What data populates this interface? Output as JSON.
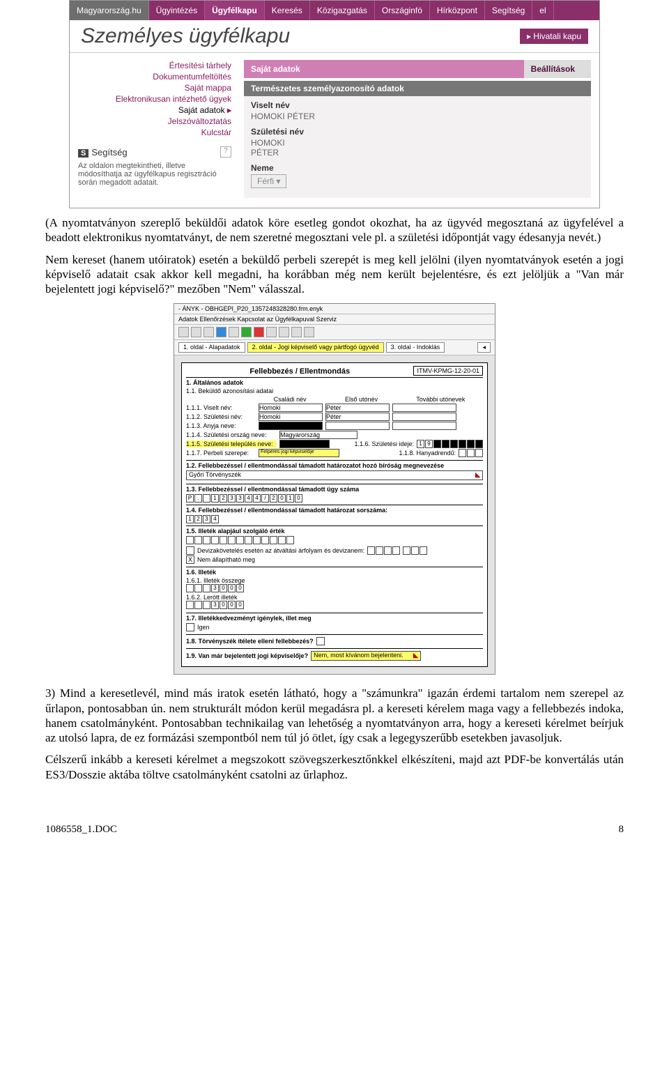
{
  "shot1": {
    "top": [
      "Magyarország.hu",
      "Ügyintézés",
      "Ügyfélkapu",
      "Keresés",
      "Közigazgatás",
      "Országinfó",
      "Hírközpont",
      "Segítség",
      "el"
    ],
    "top_selected_index": 2,
    "title": "Személyes ügyfélkapu",
    "hivatali": "▸ Hivatali kapu",
    "leftmenu": {
      "items": [
        "Értesítési tárhely",
        "Dokumentumfeltöltés",
        "Saját mappa",
        "Elektronikusan intézhető ügyek",
        "Saját adatok",
        "Jelszóváltoztatás",
        "Kulcstár"
      ],
      "selected_index": 4,
      "help_badge": "S",
      "help_title": "Segítség",
      "help_text": "Az oldalon megtekintheti, illetve módosíthatja az ügyfélkapus regisztráció során megadott adatait."
    },
    "tabs": {
      "t1": "Saját adatok",
      "t2": "Beállítások"
    },
    "section_head": "Természetes személyazonosító adatok",
    "fields": {
      "viselt_lbl": "Viselt név",
      "viselt_val": "HOMOKI PÉTER",
      "szul_lbl": "Születési név",
      "szul_val1": "HOMOKI",
      "szul_val2": "PÉTER",
      "neme_lbl": "Neme",
      "neme_val": "Férfi"
    }
  },
  "para1": "(A nyomtatványon szereplő beküldői adatok köre esetleg gondot okozhat, ha az ügyvéd megosztaná az ügyfelével a beadott elektronikus nyomtatványt, de nem szeretné megosztani vele pl. a születési időpontját vagy édesanyja nevét.)",
  "para2": "Nem kereset (hanem utóiratok) esetén a beküldő perbeli szerepét is meg kell jelölni (ilyen nyomtatványok esetén a jogi képviselő adatait csak akkor kell megadni, ha korábban még nem került bejelentésre, és ezt jelöljük a \"Van már bejelentett jogi képviselő?\" mezőben \"Nem\" válasszal.",
  "shot2": {
    "win": "- ÁNYK - OBHGEPI_P20_1357248328280.frm.enyk",
    "menu": "Adatok   Ellenőrzések   Kapcsolat az Ügyfélkapuval   Szerviz",
    "pagetabs": {
      "t1": "1. oldal - Alapadatok",
      "t2": "2. oldal - Jogi képviselő vagy pártfogó ügyvéd",
      "t3": "3. oldal - Indoklás"
    },
    "form": {
      "title": "Fellebbezés / Ellentmondás",
      "form_id": "ITMV-KPMG-12-20-01",
      "s1_head": "1. Általános adatok",
      "s11": "1.1. Beküldő azonosítási adatai",
      "hcols": [
        "Családi név",
        "Első utónév",
        "További utónevek"
      ],
      "r111_lab": "1.1.1. Viselt név:",
      "r111_a": "Homoki",
      "r111_b": "Péter",
      "r112_lab": "1.1.2. Születési név:",
      "r112_a": "Homoki",
      "r112_b": "Péter",
      "r113_lab": "1.1.3. Anyja neve:",
      "r114_lab": "1.1.4. Születési ország neve:",
      "r114_val": "Magyarország",
      "r115_lab": "1.1.5. Születési település neve:",
      "r116_lab": "1.1.6. Születési ideje:",
      "r116_val": "19",
      "r117_lab": "1.1.7. Perbeli szerepe:",
      "r117_val": "Felperes jogi képviselője",
      "r118_lab": "1.1.8. Hanyadrendű:",
      "s12": "1.2. Fellebbezéssel / ellentmondással támadott határozatot hozó bíróság megnevezése",
      "s12_val": "Győri Törvényszék",
      "s13": "1.3. Fellebbezéssel / ellentmondással támadott ügy száma",
      "s13_boxes": [
        "P",
        ".",
        "",
        "1",
        "2",
        "3",
        "3",
        "4",
        "4",
        "/",
        "2",
        "0",
        "1",
        "0"
      ],
      "s14": "1.4. Fellebbezéssel / ellentmondással támadott határozat sorszáma:",
      "s14_boxes": [
        "1",
        "2",
        "3",
        "4"
      ],
      "s15": "1.5. Illeték alapjául szolgáló érték",
      "s15_opt1": "Devizakövetelés esetén az átváltási árfolyam és devizanem:",
      "s15_opt2": "Nem állapítható meg",
      "s15_opt2_checked": "X",
      "s16": "1.6. Illeték",
      "s161": "1.6.1. Illeték összege",
      "s161_boxes": [
        "",
        "",
        "",
        "3",
        "0",
        "0",
        "0"
      ],
      "s162": "1.6.2. Lerótt illeték",
      "s162_boxes": [
        "",
        "",
        "",
        "3",
        "0",
        "0",
        "0"
      ],
      "s17": "1.7. Illetékkedvezményt igénylek, illet meg",
      "s17_opt": "Igen",
      "s18": "1.8. Törvényszék ítélete elleni fellebbezés?",
      "s19": "1.9. Van már bejelentett jogi képviselője?",
      "s19_val": "Nem, most kívánom bejelenteni."
    }
  },
  "para3": "3) Mind a keresetlevél, mind más iratok esetén látható, hogy a \"számunkra\" igazán érdemi tartalom nem szerepel az űrlapon, pontosabban ún. nem strukturált módon kerül megadásra pl. a kereseti kérelem maga vagy a fellebbezés indoka, hanem csatolmányként. Pontosabban technikailag van lehetőség a nyomtatványon arra, hogy a kereseti kérelmet beírjuk az utolsó lapra, de ez formázási szempontból nem túl jó ötlet, így csak a legegyszerűbb esetekben javasoljuk.",
  "para4": "Célszerű inkább a kereseti kérelmet a megszokott szövegszerkesztőnkkel elkészíteni, majd azt PDF-be konvertálás után ES3/Dosszie aktába töltve csatolmányként csatolni az űrlaphoz.",
  "footer": {
    "left": "1086558_1.DOC",
    "right": "8"
  }
}
